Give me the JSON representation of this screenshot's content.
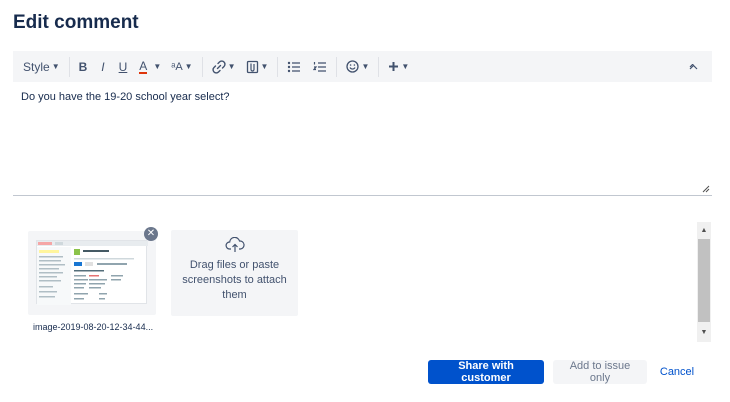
{
  "dialog": {
    "title": "Edit comment"
  },
  "toolbar": {
    "style_label": "Style",
    "bold_label": "B",
    "italic_label": "I",
    "underline_label": "U",
    "color_label": "A",
    "more_format_label": "ᵃA",
    "buttons": [
      "Style",
      "Bold",
      "Italic",
      "Underline",
      "Text color",
      "More formatting",
      "Link",
      "Attachment",
      "Bullet list",
      "Numbered list",
      "Emoji",
      "Insert more",
      "Collapse"
    ]
  },
  "editor": {
    "text": "Do you have the 19-20 school year select?"
  },
  "attachments": {
    "file_name": "image-2019-08-20-12-34-44...",
    "dropzone_text": "Drag files or paste screenshots to attach them"
  },
  "actions": {
    "share_label": "Share with customer",
    "add_label": "Add to issue only",
    "cancel_label": "Cancel"
  },
  "colors": {
    "primary": "#0052cc",
    "toolbar_bg": "#f4f5f7",
    "text": "#172b4d",
    "text_color_underline": "#de350b"
  }
}
